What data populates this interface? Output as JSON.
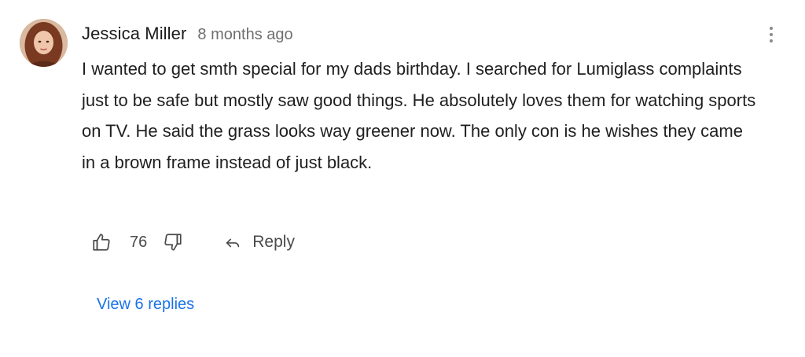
{
  "comment": {
    "author": "Jessica Miller",
    "timestamp": "8 months ago",
    "body": "I wanted to get smth special for my dads birthday. I searched for Lumiglass complaints just to be safe but mostly saw good things. He absolutely loves them for watching sports on TV. He said the grass looks way greener now. The only con is he wishes they came in a brown frame instead of just black.",
    "likes": "76",
    "reply_label": "Reply",
    "view_replies_label": "View 6 replies"
  },
  "icons": {
    "more": "more-vertical-icon",
    "like": "thumbs-up-icon",
    "dislike": "thumbs-down-icon",
    "reply": "reply-arrow-icon"
  },
  "colors": {
    "link": "#1a73e8",
    "meta": "#6f6f6f",
    "icon": "#4a4a4a"
  }
}
